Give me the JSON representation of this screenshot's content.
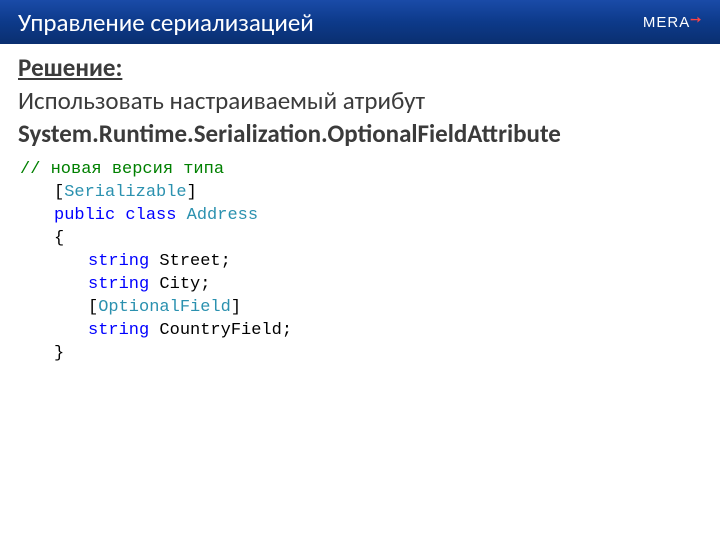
{
  "header": {
    "title": "Управление сериализацией",
    "logo": "MERA"
  },
  "body": {
    "solution_label": "Решение:",
    "solution_text": "Использовать настраиваемый атрибут",
    "attribute_name": "System.Runtime.Serialization.OptionalFieldAttribute"
  },
  "code": {
    "comment": "// новая версия типа",
    "attr_open": "[",
    "attr_serializable": "Serializable",
    "attr_close": "]",
    "kw_public": "public",
    "kw_class": "class",
    "cls_name": "Address",
    "brace_open": "{",
    "kw_string": "string",
    "field1": " Street;",
    "field2": " City;",
    "attr_optional": "OptionalField",
    "field3": " CountryField;",
    "brace_close": "}"
  }
}
